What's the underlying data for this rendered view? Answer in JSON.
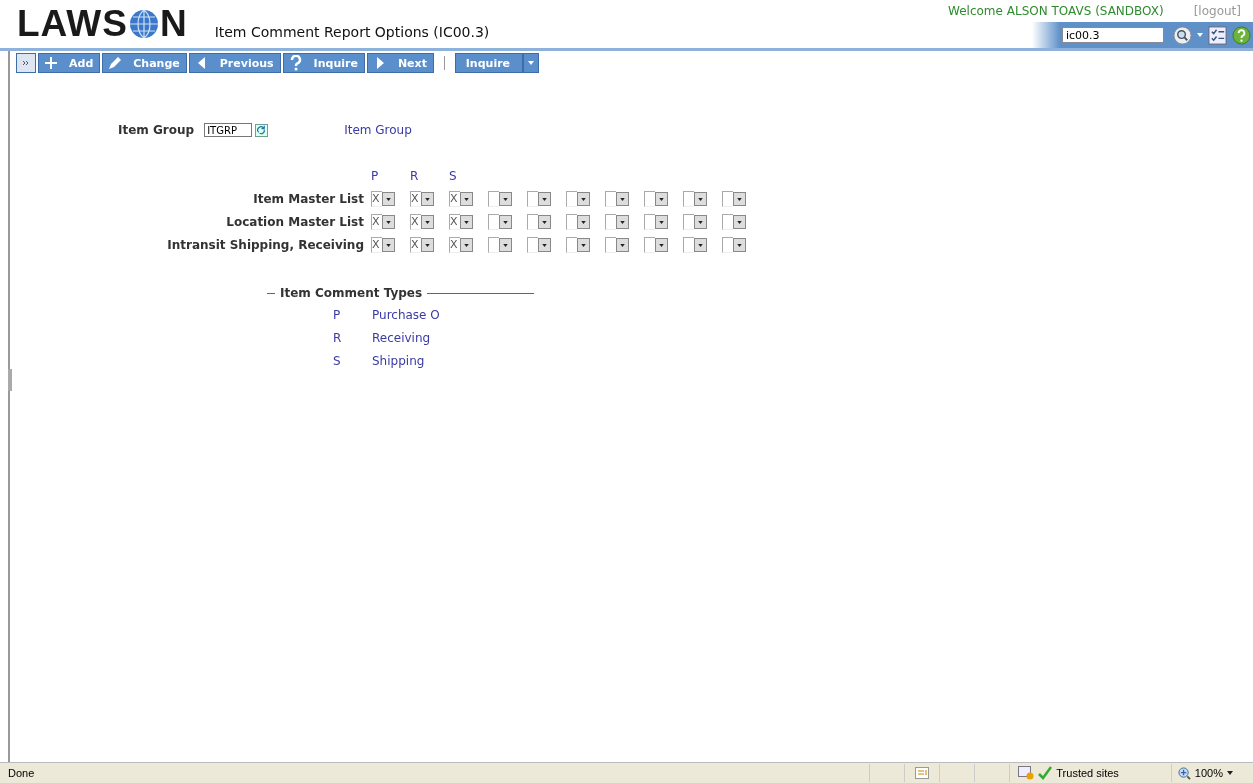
{
  "header": {
    "logo": "LAWS",
    "logo_end": "N",
    "title": "Item Comment Report Options (IC00.3)",
    "welcome": "Welcome ALSON TOAVS (SANDBOX)",
    "logout": "[logout]",
    "search_value": "ic00.3"
  },
  "toolbar": [
    {
      "label": "Add"
    },
    {
      "label": "Change"
    },
    {
      "label": "Previous"
    },
    {
      "label": "Inquire"
    },
    {
      "label": "Next"
    }
  ],
  "inquire_menu": {
    "label": "Inquire"
  },
  "item_group": {
    "label": "Item Group",
    "value": "ITGRP",
    "description": "Item Group"
  },
  "grid": {
    "columns": [
      "P",
      "R",
      "S"
    ],
    "rows": [
      {
        "label": "Item Master List",
        "cells": [
          "X",
          "X",
          "X",
          null,
          null,
          null,
          null,
          null,
          null,
          null
        ]
      },
      {
        "label": "Location Master List",
        "cells": [
          "X",
          "X",
          "X",
          null,
          null,
          null,
          null,
          null,
          null,
          null
        ]
      },
      {
        "label": "Intransit Shipping, Receiving",
        "cells": [
          "X",
          "X",
          "X",
          null,
          null,
          null,
          null,
          null,
          null,
          null
        ]
      }
    ]
  },
  "comment_types": {
    "title": "Item Comment Types",
    "items": [
      {
        "code": "P",
        "name": "Purchase O"
      },
      {
        "code": "R",
        "name": "Receiving"
      },
      {
        "code": "S",
        "name": "Shipping"
      }
    ]
  },
  "status_bar": {
    "status": "Done",
    "zone": "Trusted sites",
    "zoom": "100%"
  }
}
